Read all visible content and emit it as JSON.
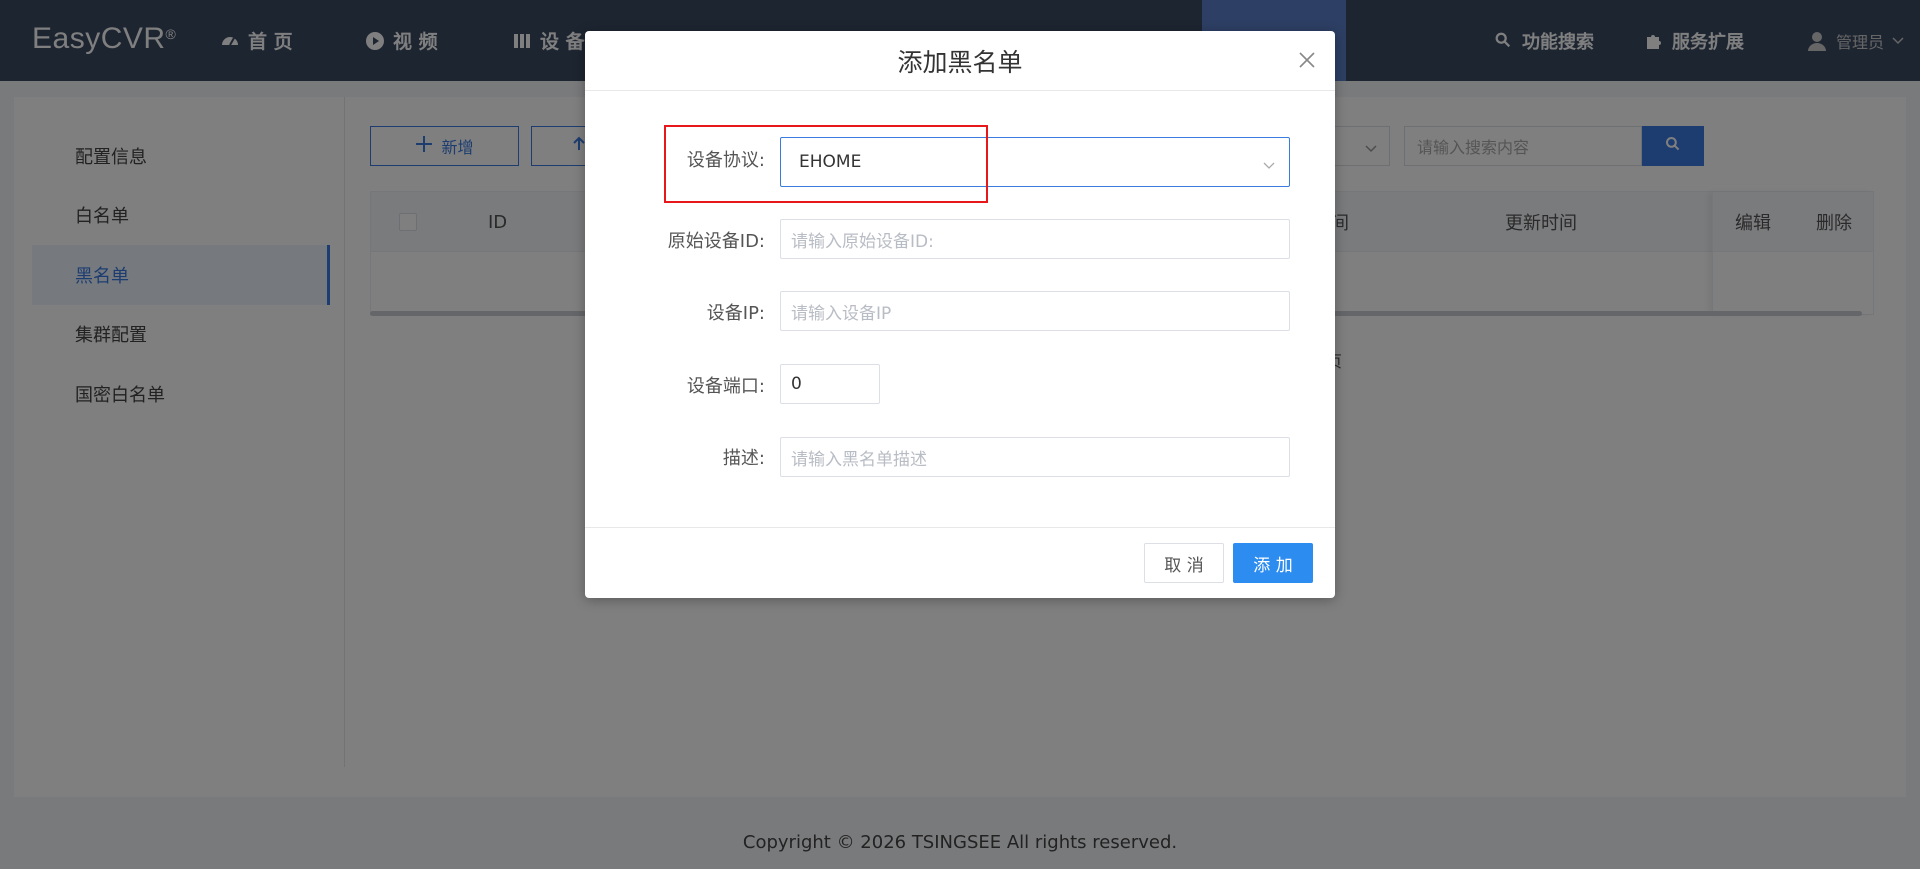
{
  "header": {
    "brand": "EasyCVR",
    "brand_mark": "®",
    "nav": [
      {
        "label": "首 页",
        "icon": "dashboard-icon"
      },
      {
        "label": "视 频",
        "icon": "play-circle-icon"
      },
      {
        "label": "设 备",
        "icon": "device-icon"
      }
    ],
    "right": [
      {
        "label": "功能搜索",
        "icon": "search-icon"
      },
      {
        "label": "服务扩展",
        "icon": "puzzle-icon"
      }
    ],
    "user": {
      "label": "管理员",
      "icon": "user-icon"
    }
  },
  "sidebar": {
    "items": [
      {
        "label": "配置信息"
      },
      {
        "label": "白名单"
      },
      {
        "label": "黑名单"
      },
      {
        "label": "集群配置"
      },
      {
        "label": "国密白名单"
      }
    ],
    "active_index": 2
  },
  "toolbar": {
    "add_label": "新增",
    "search_placeholder": "请输入搜索内容"
  },
  "table": {
    "headers": {
      "id": "ID",
      "created_time_frag": "间",
      "updated_time": "更新时间",
      "edit": "编辑",
      "delete": "删除"
    }
  },
  "pager_fragment": "页",
  "footer": {
    "copyright": "Copyright © 2026 TSINGSEE All rights reserved."
  },
  "dialog": {
    "title": "添加黑名单",
    "fields": {
      "protocol": {
        "label": "设备协议:",
        "value": "EHOME"
      },
      "device_id": {
        "label": "原始设备ID:",
        "placeholder": "请输入原始设备ID:"
      },
      "device_ip": {
        "label": "设备IP:",
        "placeholder": "请输入设备IP"
      },
      "device_port": {
        "label": "设备端口:",
        "value": "0"
      },
      "description": {
        "label": "描述:",
        "placeholder": "请输入黑名单描述"
      }
    },
    "cancel_label": "取 消",
    "add_label": "添 加"
  },
  "colors": {
    "navbar": "#3b4a63",
    "accent": "#3a7be0",
    "primary_button": "#2d8cf0",
    "highlight": "#e8181a"
  }
}
